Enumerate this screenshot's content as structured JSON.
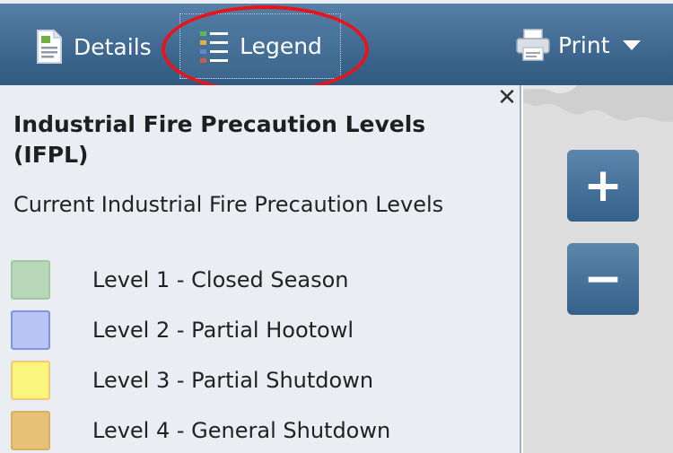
{
  "toolbar": {
    "details_label": "Details",
    "legend_label": "Legend",
    "print_label": "Print"
  },
  "icons": {
    "details": "details-document-icon",
    "legend": "legend-list-icon",
    "print": "printer-icon",
    "print_menu": "caret-down-icon",
    "close": "close-icon"
  },
  "highlight": {
    "color": "#e8141b",
    "target": "legend-button"
  },
  "legend": {
    "title": "Industrial Fire Precaution Levels (IFPL)",
    "subtitle": "Current Industrial Fire Precaution Levels",
    "close_glyph": "✕",
    "items": [
      {
        "label": "Level 1 - Closed Season",
        "fill": "#b7d7b7",
        "border": "#a2c5a2"
      },
      {
        "label": "Level 2 - Partial Hootowl",
        "fill": "#b8c4f5",
        "border": "#7f95da"
      },
      {
        "label": "Level 3 - Partial Shutdown",
        "fill": "#fbf57e",
        "border": "#f1c77a"
      },
      {
        "label": "Level 4 - General Shutdown",
        "fill": "#e6c277",
        "border": "#d7b066"
      }
    ]
  },
  "map": {
    "zoom_in_label": "+",
    "zoom_out_label": "−"
  }
}
